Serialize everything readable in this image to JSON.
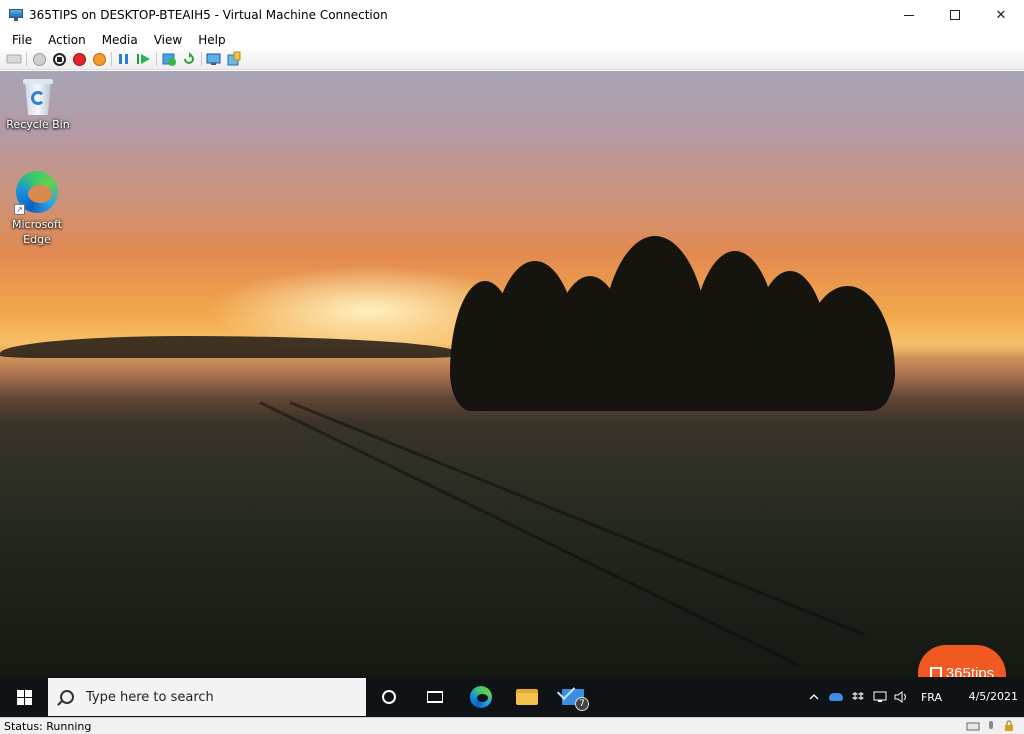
{
  "window": {
    "title": "365TIPS on DESKTOP-BTEAIH5 - Virtual Machine Connection",
    "controls": {
      "minimize": "minimize-icon",
      "maximize": "maximize-icon",
      "close": "✕"
    }
  },
  "menu": {
    "items": [
      "File",
      "Action",
      "Media",
      "View",
      "Help"
    ]
  },
  "toolbar": {
    "icons": [
      "ctrl-alt-del-icon",
      "start-icon",
      "turn-off-icon",
      "shut-down-icon",
      "save-icon",
      "pause-icon",
      "reset-icon",
      "checkpoint-icon",
      "revert-icon",
      "enhanced-session-icon",
      "share-icon"
    ]
  },
  "desktop": {
    "icons": [
      {
        "label": "Recycle Bin",
        "icon": "recycle-bin-icon"
      },
      {
        "label": "Microsoft Edge",
        "icon": "edge-icon"
      }
    ]
  },
  "taskbar": {
    "search_placeholder": "Type here to search",
    "pinned": [
      "cortana-icon",
      "task-view-icon",
      "edge-icon",
      "file-explorer-icon",
      "mail-icon"
    ],
    "mail_badge": "7",
    "tray": {
      "icons": [
        "chevron-up-icon",
        "onedrive-icon",
        "dropbox-icon",
        "network-icon",
        "volume-icon"
      ],
      "language": "FRA",
      "date": "4/5/2021"
    }
  },
  "watermark": {
    "text": "365tips"
  },
  "status": {
    "text": "Status: Running"
  },
  "colors": {
    "taskbar": "#101316",
    "accent": "#f05a22",
    "search_box": "#f3f3f3"
  }
}
